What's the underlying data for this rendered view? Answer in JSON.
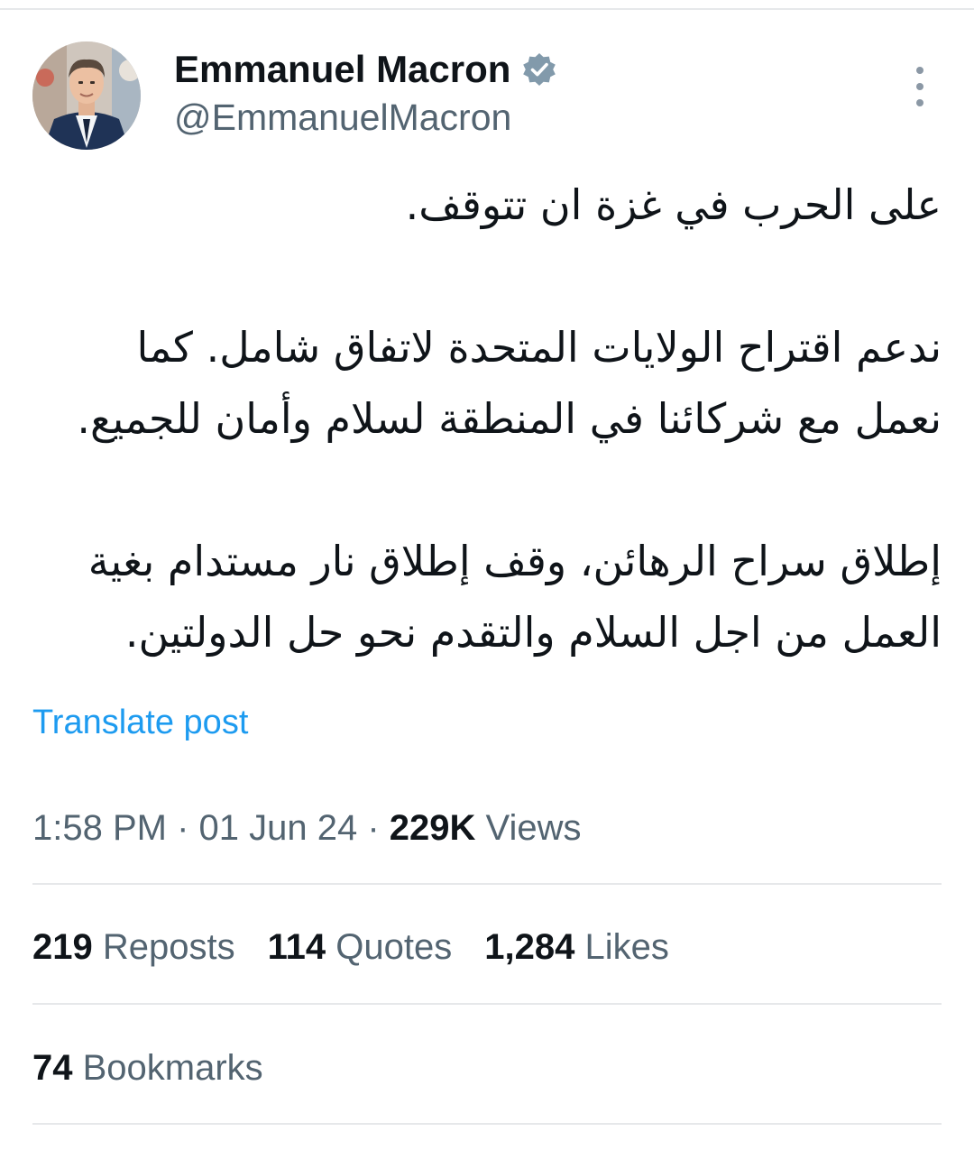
{
  "author": {
    "display_name": "Emmanuel Macron",
    "handle": "@EmmanuelMacron",
    "verified_icon": "verified-badge-icon",
    "verified_color": "#829aab"
  },
  "post": {
    "paragraphs": [
      [
        "على الحرب في غزة ان تتوقف."
      ],
      [
        "ندعم اقتراح الولايات المتحدة لاتفاق شامل. كما",
        "نعمل مع شركائنا في المنطقة لسلام وأمان للجميع."
      ],
      [
        "إطلاق سراح الرهائن، وقف إطلاق نار مستدام بغية",
        "العمل من اجل السلام والتقدم نحو حل الدولتين."
      ]
    ],
    "translate_label": "Translate post"
  },
  "meta": {
    "time": "1:58 PM",
    "separator": " · ",
    "date": "01 Jun 24",
    "views_count": "229K",
    "views_label": " Views"
  },
  "stats": {
    "reposts": {
      "count": "219",
      "label": " Reposts"
    },
    "quotes": {
      "count": "114",
      "label": " Quotes"
    },
    "likes": {
      "count": "1,284",
      "label": " Likes"
    },
    "bookmarks": {
      "count": "74",
      "label": " Bookmarks"
    }
  },
  "colors": {
    "text_primary": "#0f1419",
    "text_secondary": "#536471",
    "link": "#1d9bf0",
    "divider": "#e6e8ea"
  },
  "icons": {
    "more": "more-options-icon"
  }
}
